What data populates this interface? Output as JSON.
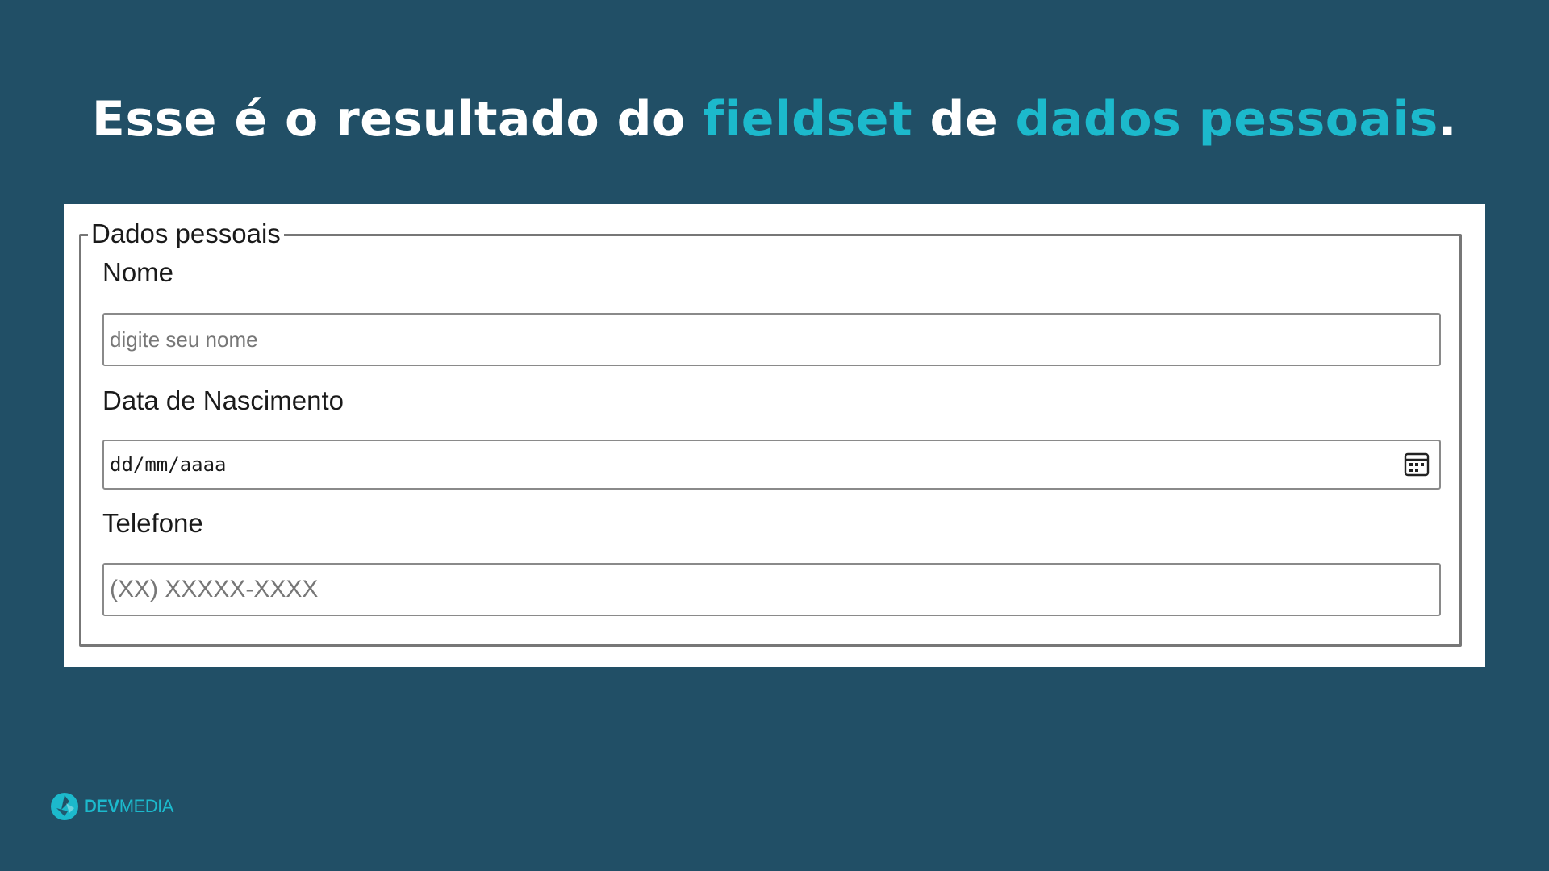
{
  "slide": {
    "title_parts": {
      "p1": "Esse é o resultado do ",
      "p2": "fieldset",
      "p3": " de ",
      "p4": "dados pessoais",
      "p5": "."
    }
  },
  "colors": {
    "background": "#214f66",
    "accent": "#1cb9cc",
    "panel": "#ffffff"
  },
  "form": {
    "legend": "Dados pessoais",
    "fields": [
      {
        "label": "Nome",
        "placeholder": "digite seu nome",
        "type": "text"
      },
      {
        "label": "Data de Nascimento",
        "placeholder": "dd/mm/aaaa",
        "type": "date",
        "icon": "calendar-icon"
      },
      {
        "label": "Telefone",
        "placeholder": "(XX) XXXXX-XXXX",
        "type": "tel"
      }
    ]
  },
  "brand": {
    "name_bold": "DEV",
    "name_regular": "MEDIA",
    "icon": "devmedia-logo-icon"
  }
}
